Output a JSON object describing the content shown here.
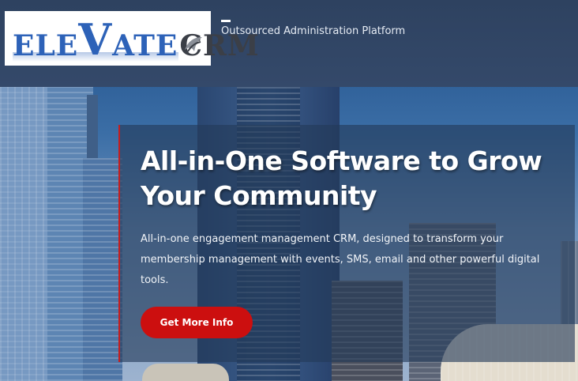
{
  "header": {
    "logo": {
      "part1": "ELE",
      "big_letter": "V",
      "part2": "ATE",
      "part3": "CRM"
    },
    "tagline": "Outsourced Administration Platform"
  },
  "hero": {
    "title": "All-in-One Software to Grow Your Community",
    "description": "All-in-one engagement management CRM, designed to transform your membership management with events, SMS, email and other powerful digital tools.",
    "cta_label": "Get More Info"
  },
  "colors": {
    "header_bg": "#2e4260",
    "accent": "#cc0f0f",
    "logo_blue": "#2d62b8",
    "logo_gray": "#3b3f47"
  },
  "icons": {
    "logo_mark": "crm-swoosh-icon"
  }
}
